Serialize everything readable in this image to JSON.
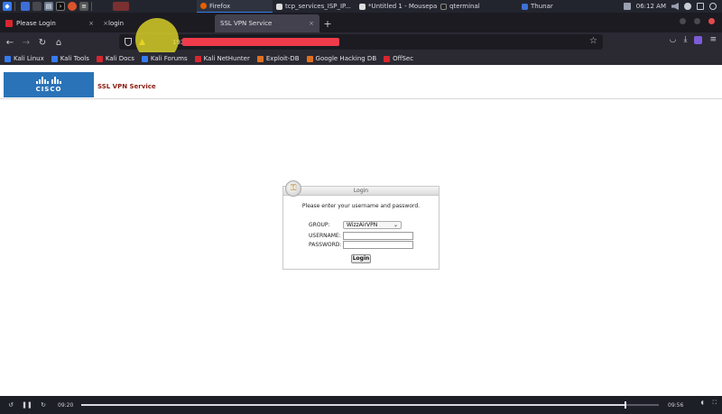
{
  "taskbar": {
    "apps": [
      {
        "name": "kali-menu-icon",
        "color": "#367bf0"
      },
      {
        "name": "workspace-1-icon",
        "color": "#3d6fd6"
      },
      {
        "name": "workspace-2-icon",
        "color": "#46474f"
      }
    ],
    "launchers": [
      "files-icon",
      "terminal-icon",
      "firefox-icon",
      "text-editor-icon"
    ],
    "tasks": [
      {
        "label": "Firefox",
        "color": "#e66000",
        "active": true
      },
      {
        "label": "tcp_services_ISP_IP...",
        "color": "#dddddd",
        "active": false
      },
      {
        "label": "*Untitled 1 - Mousepad",
        "color": "#dddddd",
        "active": false
      },
      {
        "label": "qterminal",
        "color": "#222222",
        "active": false
      },
      {
        "label": "Thunar",
        "color": "#3d6fd6",
        "active": false
      }
    ],
    "clock": "06:12 AM"
  },
  "browser": {
    "tabs": [
      {
        "label": "Please Login",
        "close": "×",
        "active": false,
        "favicon_color": "#d8262e"
      },
      {
        "label": "login",
        "close": "×",
        "active": false,
        "favicon_color": "#888888"
      },
      {
        "label": "SSL VPN Service",
        "close": "×",
        "active": true,
        "favicon_color": "#888888"
      }
    ],
    "new_tab": "+",
    "url_prefix": "193.",
    "bookmarks": [
      {
        "label": "Kali Linux",
        "color": "#367bf0"
      },
      {
        "label": "Kali Tools",
        "color": "#367bf0"
      },
      {
        "label": "Kali Docs",
        "color": "#d8262e"
      },
      {
        "label": "Kali Forums",
        "color": "#367bf0"
      },
      {
        "label": "Kali NetHunter",
        "color": "#d8262e"
      },
      {
        "label": "Exploit-DB",
        "color": "#e07020"
      },
      {
        "label": "Google Hacking DB",
        "color": "#e07020"
      },
      {
        "label": "OffSec",
        "color": "#d8262e"
      }
    ]
  },
  "page": {
    "logo_text": "CISCO",
    "service_title": "SSL VPN Service",
    "login": {
      "title": "Login",
      "message": "Please enter your username and password.",
      "group_label": "GROUP:",
      "group_value": "WizzAirVPN",
      "username_label": "USERNAME:",
      "password_label": "PASSWORD:",
      "button": "Login"
    }
  },
  "player": {
    "current_time": "09:20",
    "total_time": "09:56",
    "progress": 0.94
  },
  "colors": {
    "accent": "#367bf0",
    "cisco_blue": "#2a73b8",
    "title_red": "#8b1c12",
    "redaction": "#ef3b4a"
  }
}
